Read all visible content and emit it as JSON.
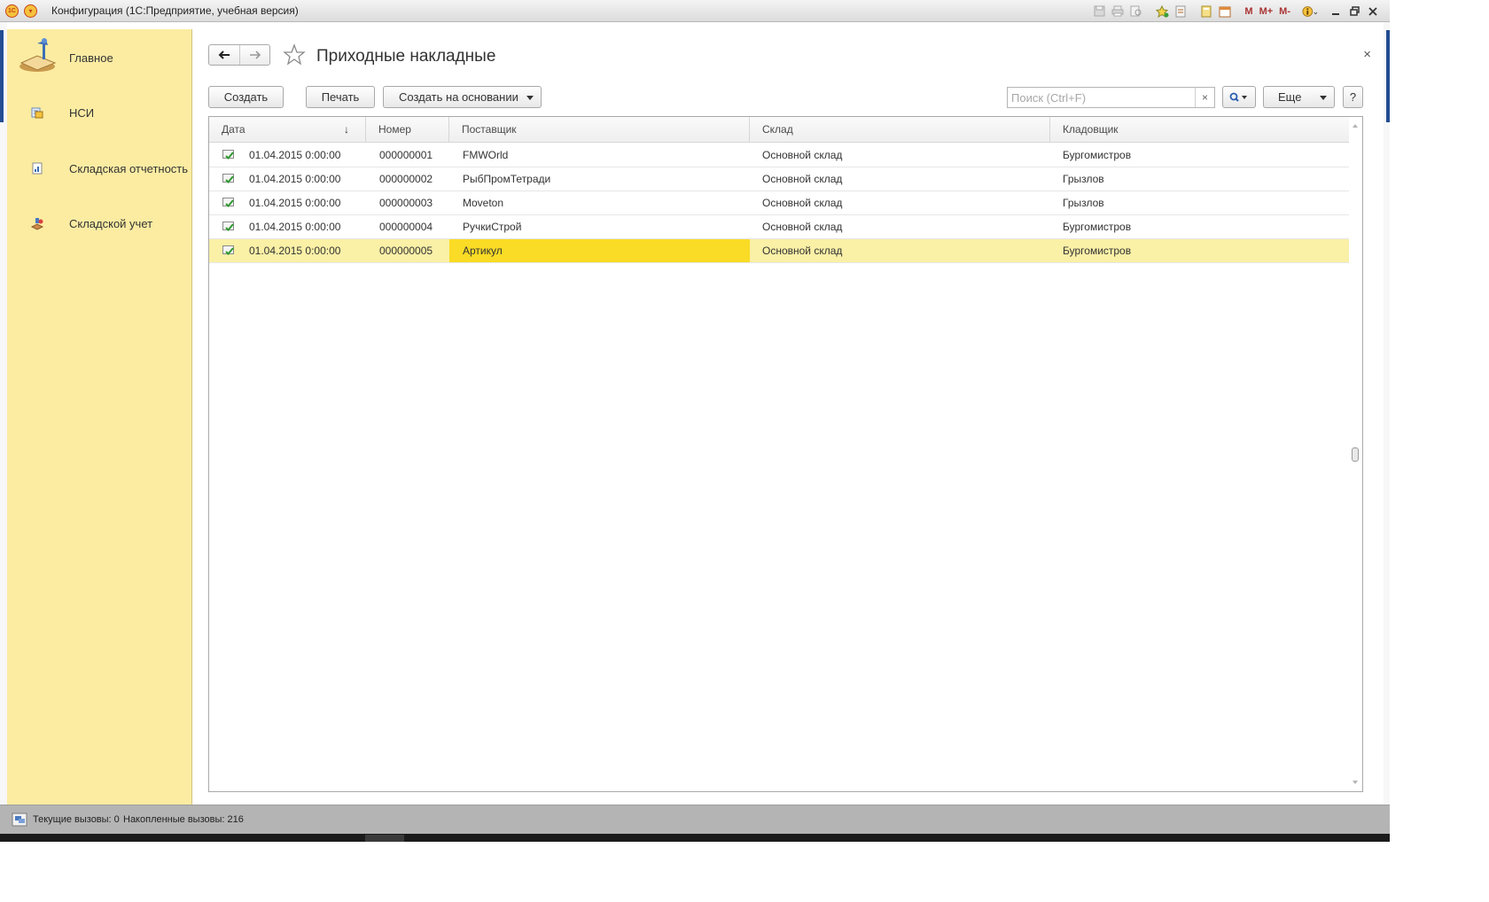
{
  "window": {
    "title": "Конфигурация  (1С:Предприятие, учебная версия)",
    "toolbar_text_buttons": [
      "M",
      "M+",
      "M-"
    ]
  },
  "sections": [
    {
      "label": "Главное",
      "icon": "home-desk-icon"
    },
    {
      "label": "НСИ",
      "icon": "reference-data-icon"
    },
    {
      "label": "Складская отчетность",
      "icon": "report-chart-icon"
    },
    {
      "label": "Складской учет",
      "icon": "warehouse-accounting-icon"
    }
  ],
  "form": {
    "title": "Приходные накладные",
    "close_glyph": "×",
    "back_glyph": "🡐",
    "forward_glyph": "🡒"
  },
  "command_bar": {
    "create": "Создать",
    "print": "Печать",
    "create_based_on": "Создать на основании",
    "search_placeholder": "Поиск (Ctrl+F)",
    "search_value": "",
    "search_clear": "×",
    "more": "Еще",
    "help": "?"
  },
  "table": {
    "columns": [
      {
        "key": "date",
        "label": "Дата",
        "sort": "↓"
      },
      {
        "key": "number",
        "label": "Номер"
      },
      {
        "key": "supplier",
        "label": "Поставщик"
      },
      {
        "key": "warehouse",
        "label": "Склад"
      },
      {
        "key": "storekeeper",
        "label": "Кладовщик"
      }
    ],
    "rows": [
      {
        "date": "01.04.2015 0:00:00",
        "number": "000000001",
        "supplier": "FMWOrld",
        "warehouse": "Основной склад",
        "storekeeper": "Бургомистров"
      },
      {
        "date": "01.04.2015 0:00:00",
        "number": "000000002",
        "supplier": "РыбПромТетради",
        "warehouse": "Основной склад",
        "storekeeper": "Грызлов"
      },
      {
        "date": "01.04.2015 0:00:00",
        "number": "000000003",
        "supplier": "Moveton",
        "warehouse": "Основной склад",
        "storekeeper": "Грызлов"
      },
      {
        "date": "01.04.2015 0:00:00",
        "number": "000000004",
        "supplier": "РучкиСтрой",
        "warehouse": "Основной склад",
        "storekeeper": "Бургомистров"
      },
      {
        "date": "01.04.2015 0:00:00",
        "number": "000000005",
        "supplier": "Артикул",
        "warehouse": "Основной склад",
        "storekeeper": "Бургомистров"
      }
    ],
    "selected_row": 4,
    "active_column": "supplier"
  },
  "status": {
    "current_calls": "Текущие вызовы: 0",
    "accumulated_calls": "Накопленные вызовы: 216"
  },
  "colors": {
    "sidebar": "#fbeca2",
    "selected_row": "#faf0a6",
    "active_cell": "#fadb25",
    "status_bar": "#b4b4b4"
  }
}
